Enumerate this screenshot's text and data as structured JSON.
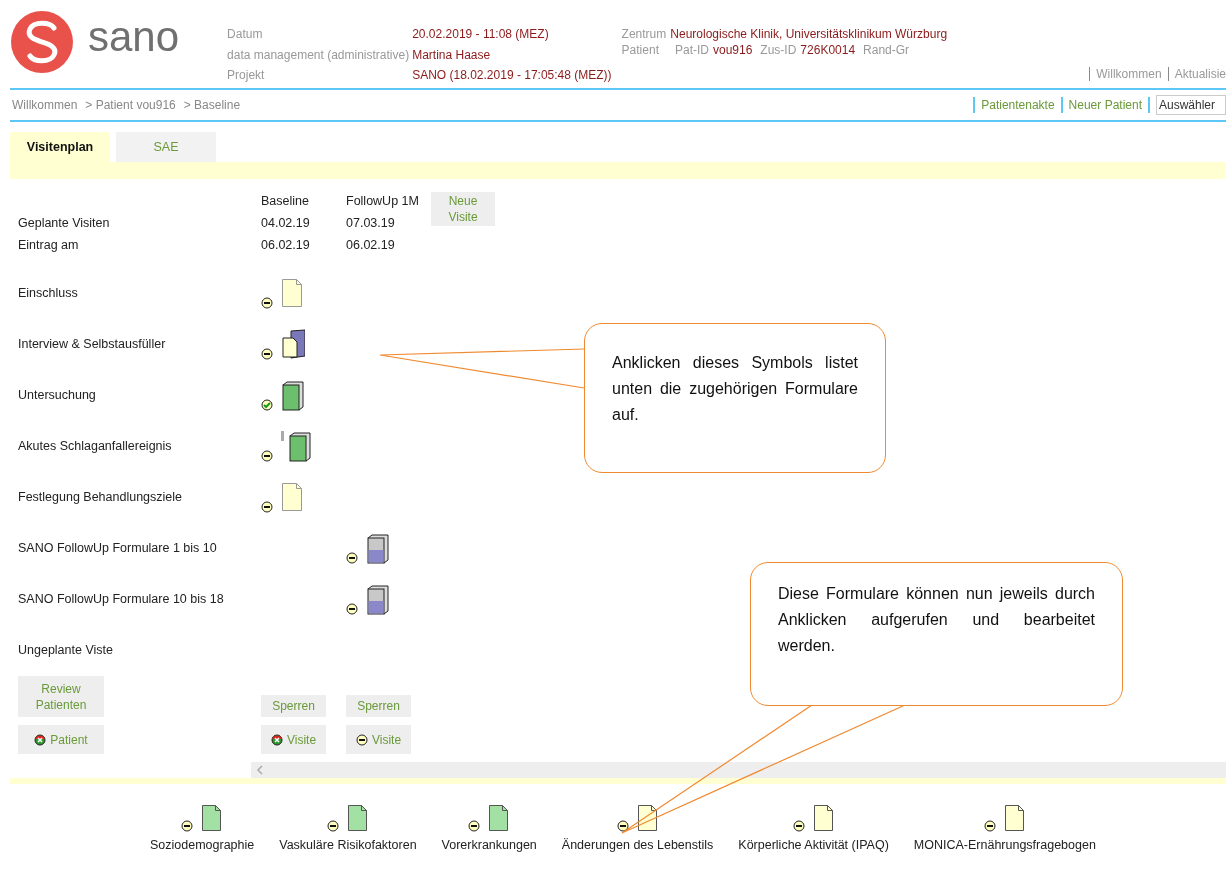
{
  "header": {
    "logo_text": "sano",
    "info": [
      {
        "label": "Datum",
        "value": "20.02.2019 - 11:08 (MEZ)"
      },
      {
        "label": "data management (administrative)",
        "value": "Martina Haase"
      },
      {
        "label": "Projekt",
        "value": "SANO (18.02.2019 - 17:05:48 (MEZ))"
      }
    ],
    "zentrum": {
      "label": "Zentrum",
      "value": "Neurologische Klinik, Universitätsklinikum Würzburg"
    },
    "patient": {
      "label": "Patient",
      "parts": [
        {
          "label": "Pat-ID",
          "value": "vou916"
        },
        {
          "label": "Zus-ID",
          "value": "726K0014"
        },
        {
          "label": "Rand-Gr"
        }
      ]
    },
    "top_links": [
      "Willkommen",
      "Aktualisie"
    ]
  },
  "breadcrumb": [
    "Willkommen",
    "> Patient vou916",
    "> Baseline"
  ],
  "actions": [
    "Patientenakte",
    "Neuer Patient"
  ],
  "select": {
    "value": "Auswähler"
  },
  "tabs": [
    {
      "label": "Visitenplan",
      "selected": true
    },
    {
      "label": "SAE",
      "selected": false
    }
  ],
  "visits": {
    "row_labels": [
      "Geplante Visiten",
      "Eintrag am"
    ],
    "columns": [
      {
        "name": "Baseline",
        "planned": "04.02.19",
        "entry": "06.02.19"
      },
      {
        "name": "FollowUp 1M",
        "planned": "07.03.19",
        "entry": "06.02.19"
      }
    ],
    "new_visit": "Neue Visite"
  },
  "form_groups": [
    {
      "label": "Einschluss",
      "baseline": {
        "done": false,
        "kind": "page",
        "warning": false
      }
    },
    {
      "label": "Interview & Selbstausfüller",
      "baseline": {
        "done": false,
        "kind": "stack",
        "warning": false
      }
    },
    {
      "label": "Untersuchung",
      "baseline": {
        "done": true,
        "kind": "book_green",
        "warning": false
      }
    },
    {
      "label": "Akutes Schlaganfallereignis",
      "baseline": {
        "done": false,
        "kind": "book_green",
        "warning": true
      }
    },
    {
      "label": "Festlegung Behandlungsziele",
      "baseline": {
        "done": false,
        "kind": "page",
        "warning": false
      }
    },
    {
      "label": "SANO FollowUp Formulare 1 bis 10",
      "followup_1m": {
        "done": false,
        "kind": "book_blue",
        "warning": false
      }
    },
    {
      "label": "SANO FollowUp Formulare 10 bis 18",
      "followup_1m": {
        "done": false,
        "kind": "book_blue",
        "warning": false
      }
    }
  ],
  "unplanned": "Ungeplante Viste",
  "review_button": "Review Patienten",
  "patient_button": {
    "label": "Patient",
    "alert": true
  },
  "lock_buttons": [
    "Sperren",
    "Sperren"
  ],
  "visit_buttons": [
    {
      "label": "Visite",
      "alert": true
    },
    {
      "label": "Visite",
      "alert": false
    }
  ],
  "forms": [
    {
      "label": "Soziodemographie",
      "done": false,
      "color": "#a3e0a3"
    },
    {
      "label": "Vaskuläre Risikofaktoren",
      "done": false,
      "color": "#a3e0a3"
    },
    {
      "label": "Vorerkrankungen",
      "done": false,
      "color": "#a3e0a3"
    },
    {
      "label": "Änderungen des Lebenstils",
      "done": false,
      "color": "#ffffd2"
    },
    {
      "label": "Körperliche Aktivität (IPAQ)",
      "done": false,
      "color": "#ffffd2"
    },
    {
      "label": "MONICA-Ernährungsfragebogen",
      "done": false,
      "color": "#ffffd2"
    }
  ],
  "callouts": [
    "Anklicken dieses Symbols listet unten die zugehörigen Formulare auf.",
    "Diese Formulare können nun jeweils durch Anklicken aufgerufen und bearbeitet werden."
  ]
}
